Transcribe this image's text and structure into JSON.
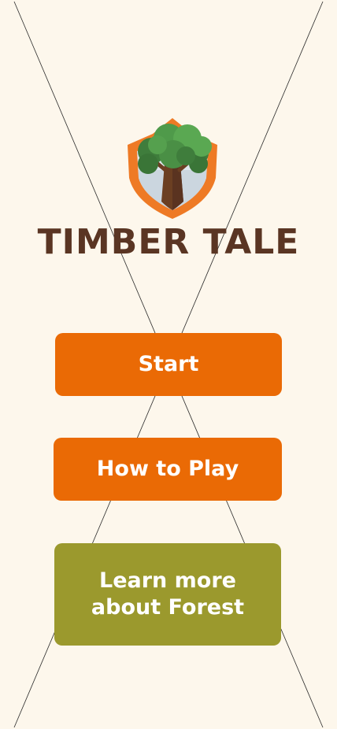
{
  "app": {
    "title": "TIMBER TALE"
  },
  "logo": {
    "icon": "tree-shield-icon"
  },
  "menu": {
    "start_label": "Start",
    "how_to_play_label": "How to Play",
    "learn_more_label": "Learn more\nabout Forest"
  },
  "colors": {
    "background": "#fdf7ec",
    "primary_button": "#ea6a05",
    "secondary_button": "#9b992d",
    "title": "#5a3523",
    "shield_orange": "#ee7a25"
  }
}
